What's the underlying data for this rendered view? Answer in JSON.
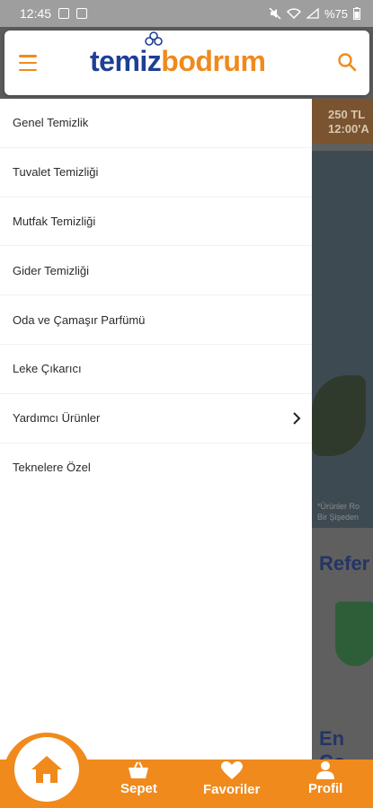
{
  "status": {
    "time": "12:45",
    "battery": "%75"
  },
  "header": {
    "logo_part1": "temiz",
    "logo_part2": "bodrum"
  },
  "drawer": {
    "items": [
      {
        "label": "Genel Temizlik"
      },
      {
        "label": "Tuvalet Temizliği"
      },
      {
        "label": "Mutfak Temizliği"
      },
      {
        "label": "Gider Temizliği"
      },
      {
        "label": "Oda ve Çamaşır Parfümü"
      },
      {
        "label": "Leke Çıkarıcı"
      },
      {
        "label": "Yardımcı Ürünler"
      },
      {
        "label": "Teknelere Özel"
      }
    ]
  },
  "background": {
    "banner_line1": "250 TL",
    "banner_line2": "12:00'A",
    "caption_line1": "*Ürünler Ro",
    "caption_line2": "Bir Şişeden",
    "references_heading": "Refer",
    "bestseller_heading": "En Ço"
  },
  "bottom_nav": {
    "home": "home-icon",
    "cart": "Sepet",
    "favorites": "Favoriler",
    "profile": "Profil"
  },
  "colors": {
    "accent": "#f08a1c",
    "brand_blue": "#1d3f94"
  }
}
